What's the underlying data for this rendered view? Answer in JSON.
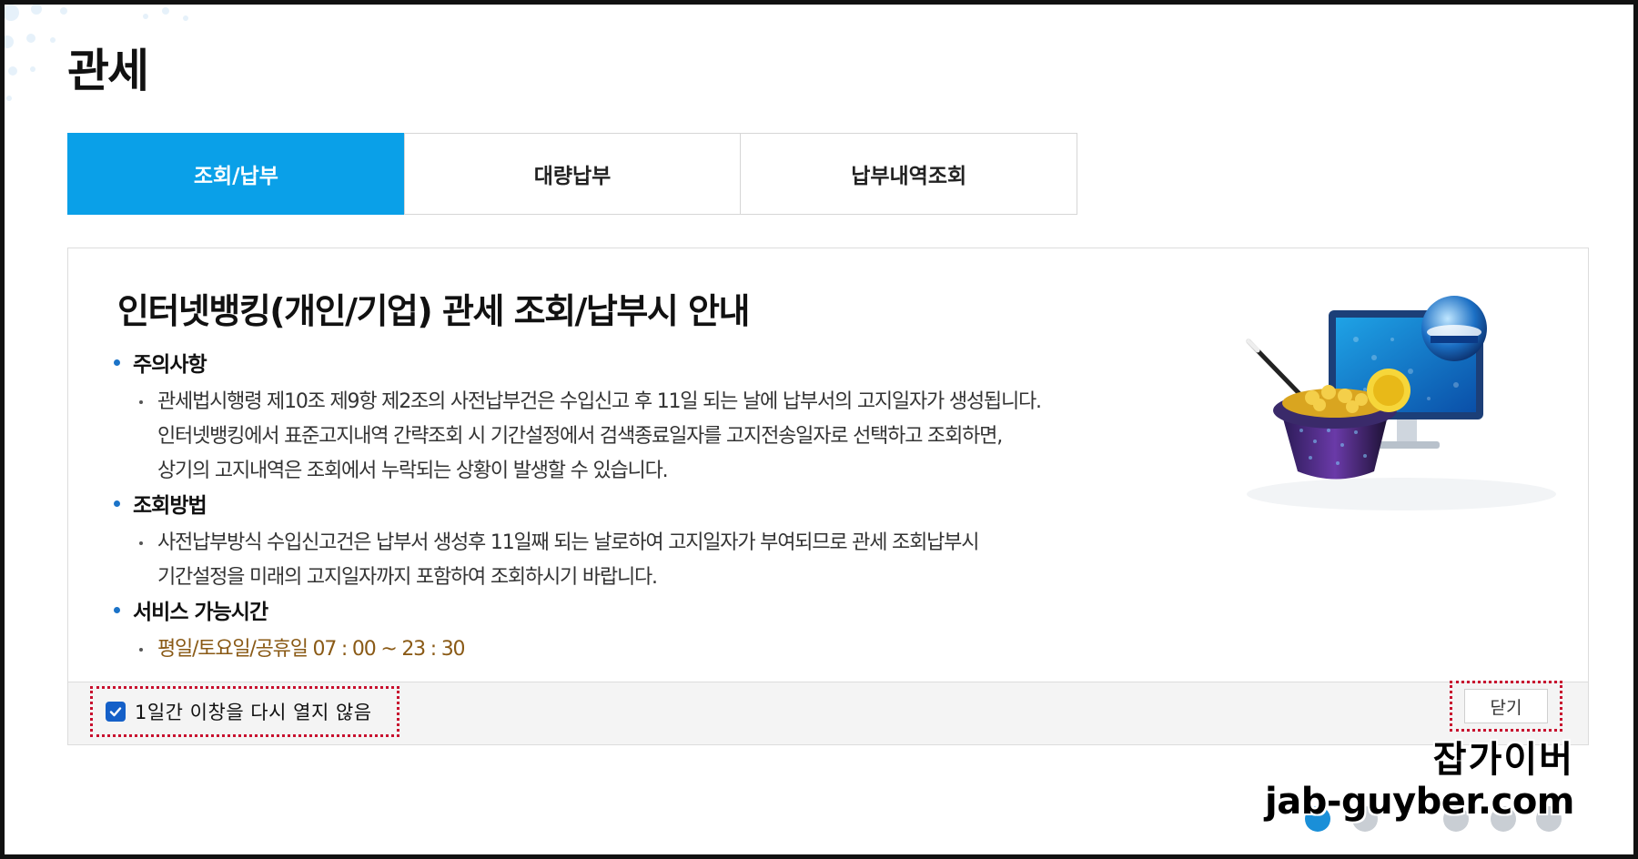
{
  "page": {
    "title": "관세"
  },
  "tabs": [
    {
      "label": "조회/납부",
      "active": true
    },
    {
      "label": "대량납부",
      "active": false
    },
    {
      "label": "납부내역조회",
      "active": false
    }
  ],
  "notice": {
    "heading": "인터넷뱅킹(개인/기업) 관세 조회/납부시 안내",
    "sections": [
      {
        "title": "주의사항",
        "lines": [
          "관세법시행령 제10조 제9항 제2조의 사전납부건은 수입신고 후 11일 되는 날에 납부서의 고지일자가 생성됩니다.",
          "인터넷뱅킹에서 표준고지내역 간략조회 시 기간설정에서 검색종료일자를 고지전송일자로 선택하고 조회하면,",
          "상기의 고지내역은 조회에서 누락되는 상황이 발생할 수 있습니다."
        ]
      },
      {
        "title": "조회방법",
        "lines": [
          "사전납부방식 수입신고건은 납부서 생성후 11일째 되는 날로하여 고지일자가 부여되므로 관세 조회납부시",
          "기간설정을 미래의 고지일자까지 포함하여 조회하시기 바랍니다."
        ]
      },
      {
        "title": "서비스 가능시간",
        "lines": [
          "평일/토요일/공휴일 07 : 00 ~ 23 : 30"
        ]
      }
    ],
    "illustration_icon": "magic-hat-monitor-illustration"
  },
  "footer": {
    "checkbox_label": "1일간 이창을 다시 열지 않음",
    "checkbox_checked": true,
    "close_label": "닫기"
  },
  "watermark": {
    "line1": "잡가이버",
    "line2": "jab-guyber.com"
  },
  "colors": {
    "active_tab": "#0aa0e8",
    "bullet": "#1b73c8",
    "hours_text": "#8a5a16",
    "highlight_border": "#c8102e"
  }
}
